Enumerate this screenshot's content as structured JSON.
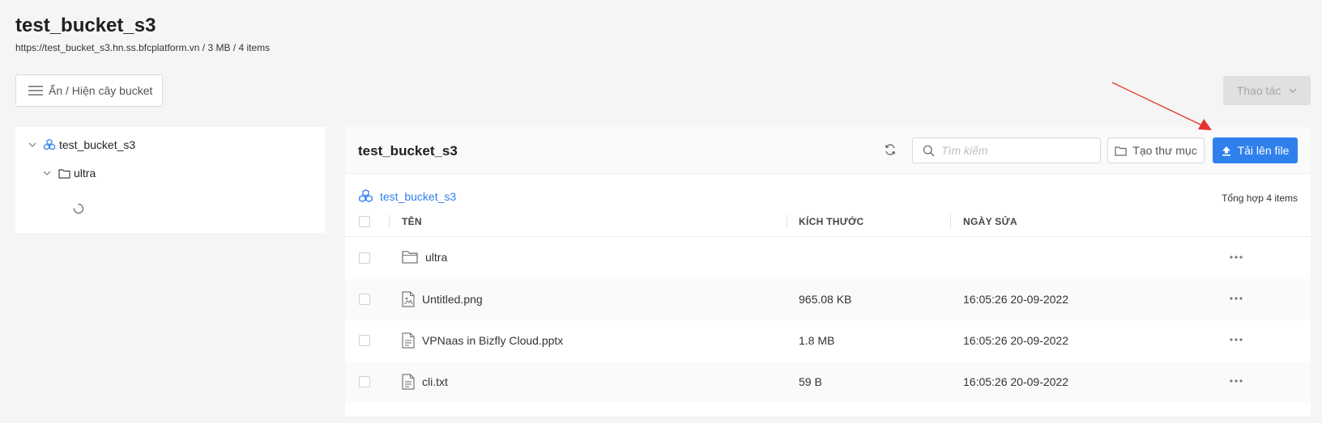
{
  "header": {
    "title": "test_bucket_s3",
    "subtitle": "https://test_bucket_s3.hn.ss.bfcplatform.vn / 3 MB / 4 items"
  },
  "toolbar": {
    "toggle_tree_label": "Ẩn / Hiện cây bucket",
    "actions_label": "Thao tác"
  },
  "tree": {
    "root_label": "test_bucket_s3",
    "child_label": "ultra"
  },
  "main": {
    "title": "test_bucket_s3",
    "search_placeholder": "Tìm kiếm",
    "new_folder_label": "Tạo thư mục",
    "upload_label": "Tải lên file",
    "breadcrumb_label": "test_bucket_s3",
    "total_label": "Tổng hợp 4 items"
  },
  "table": {
    "columns": {
      "name": "TÊN",
      "size": "KÍCH THƯỚC",
      "modified": "NGÀY SỬA"
    },
    "rows": [
      {
        "name": "ultra",
        "size": "",
        "modified": "",
        "icon": "folder-icon"
      },
      {
        "name": "Untitled.png",
        "size": "965.08 KB",
        "modified": "16:05:26 20-09-2022",
        "icon": "image-file-icon"
      },
      {
        "name": "VPNaas in Bizfly Cloud.pptx",
        "size": "1.8 MB",
        "modified": "16:05:26 20-09-2022",
        "icon": "document-file-icon"
      },
      {
        "name": "cli.txt",
        "size": "59 B",
        "modified": "16:05:26 20-09-2022",
        "icon": "document-file-icon"
      }
    ]
  },
  "colors": {
    "primary": "#2f80ed",
    "annotation_arrow": "#e5322d"
  }
}
